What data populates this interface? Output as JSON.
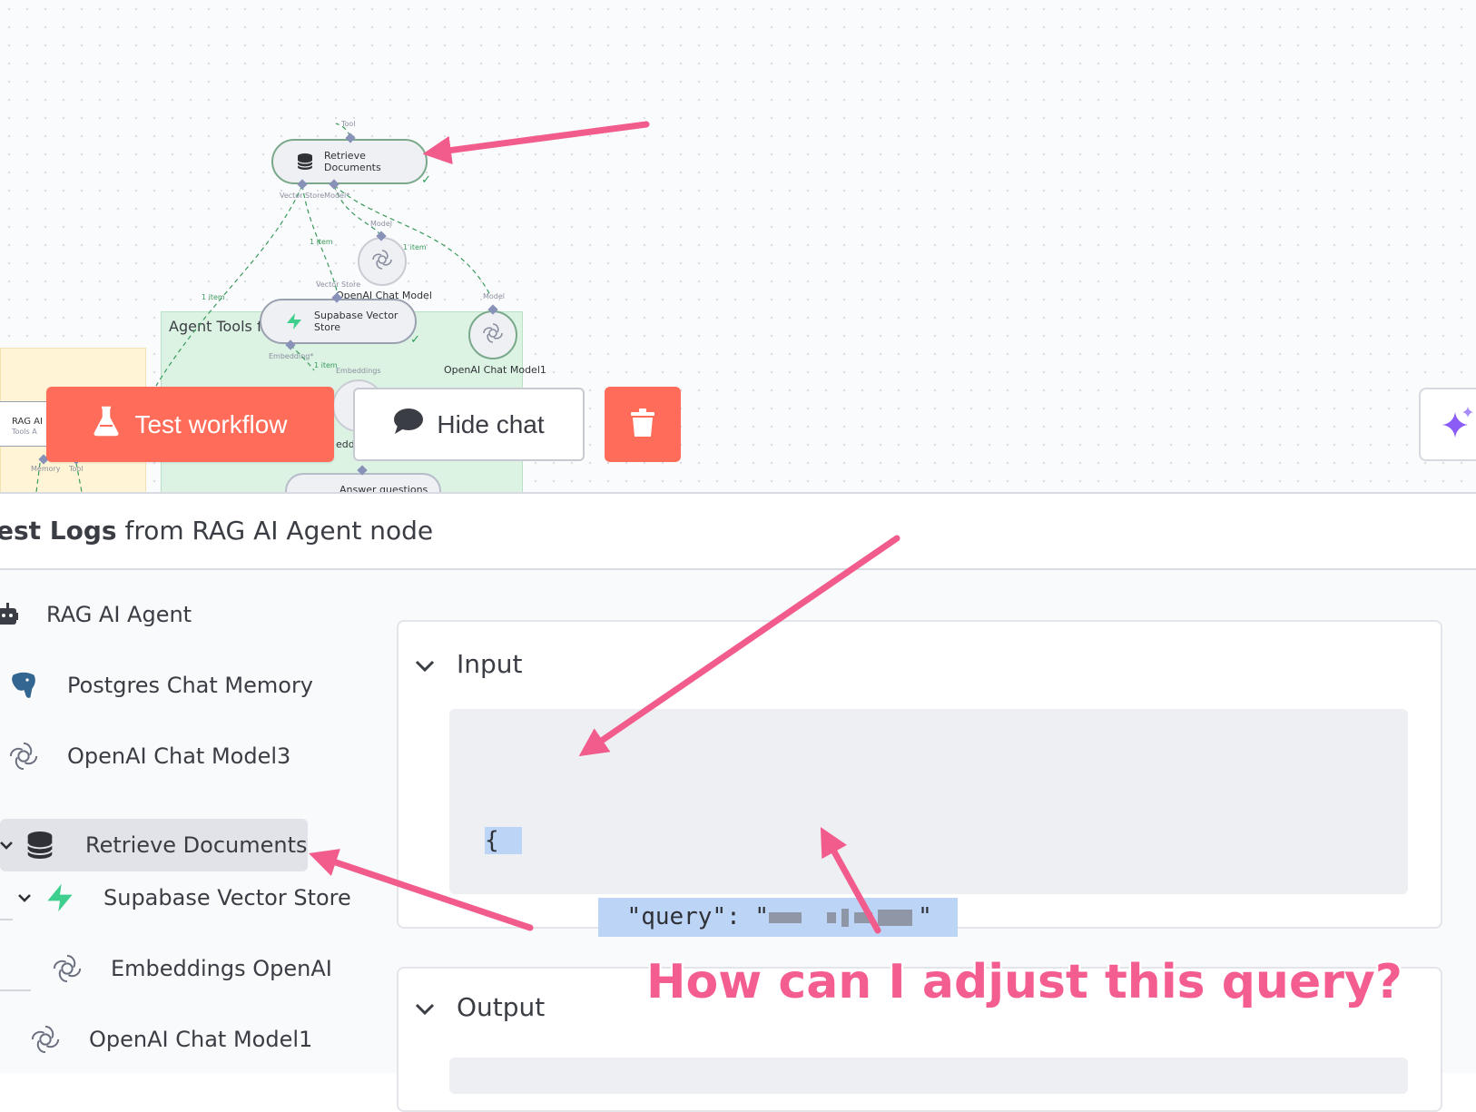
{
  "canvas": {
    "group_title": "Agent Tools f",
    "nodes": {
      "retrieve_documents": "Retrieve\nDocuments",
      "openai_chat_model": "OpenAI Chat Model",
      "supabase_vector_store": "Supabase Vector\nStore",
      "openai_chat_model1": "OpenAI Chat Model1",
      "rag_ai_small": "RAG AI",
      "rag_ai_small_sub": "Tools A",
      "embeddings_partial": "eddi",
      "answer_questions": "Answer questions"
    },
    "connection_labels": {
      "tool": "Tool",
      "vector_store_model": "Vector StoreModel*",
      "one_item": "1 item",
      "model": "Model",
      "vector_store": "Vector Store",
      "embedding": "Embedding*",
      "embeddings": "Embeddings",
      "memory": "Memory",
      "tool2": "Tool"
    }
  },
  "toolbar": {
    "test_workflow_label": "Test workflow",
    "hide_chat_label": "Hide chat"
  },
  "logs": {
    "title_bold": "est Logs",
    "title_rest": " from RAG AI Agent node",
    "tree": [
      {
        "label": "RAG AI Agent",
        "icon": "robot-icon"
      },
      {
        "label": "Postgres Chat Memory",
        "icon": "postgres-elephant-icon"
      },
      {
        "label": "OpenAI Chat Model3",
        "icon": "openai-icon"
      },
      {
        "label": "Retrieve Documents",
        "icon": "database-icon",
        "selected": true
      },
      {
        "label": "Supabase Vector Store",
        "icon": "supabase-icon"
      },
      {
        "label": "Embeddings OpenAI",
        "icon": "openai-icon"
      },
      {
        "label": "OpenAI Chat Model1",
        "icon": "openai-icon"
      }
    ],
    "input": {
      "label": "Input",
      "line1": "{",
      "line2_key": "  \"query\": \"",
      "line2_end": "\"",
      "line3": "}"
    },
    "output": {
      "label": "Output"
    }
  },
  "annotation": {
    "text": "How can I adjust this query?"
  }
}
